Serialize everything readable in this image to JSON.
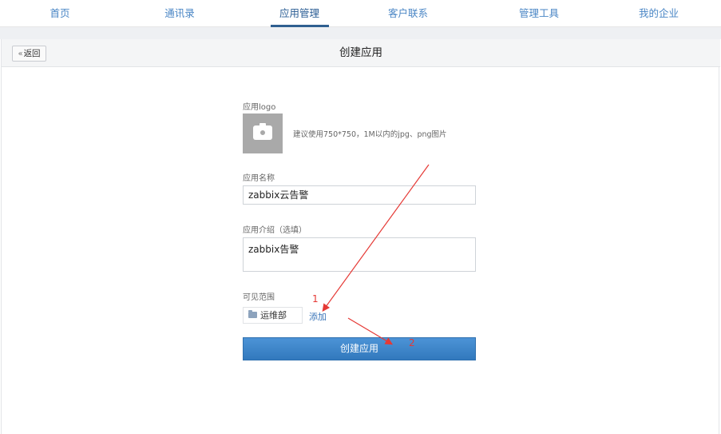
{
  "nav": {
    "items": [
      {
        "label": "首页"
      },
      {
        "label": "通讯录"
      },
      {
        "label": "应用管理"
      },
      {
        "label": "客户联系"
      },
      {
        "label": "管理工具"
      },
      {
        "label": "我的企业"
      }
    ],
    "active_index": 2,
    "accent_color": "#2f5f90"
  },
  "header": {
    "back_label": "返回",
    "back_icon": "double-chevron-left-icon",
    "title": "创建应用"
  },
  "form": {
    "logo_label": "应用logo",
    "logo_icon": "camera-icon",
    "logo_hint": "建议使用750*750，1M以内的jpg、png图片",
    "name_label": "应用名称",
    "name_value": "zabbix云告警",
    "desc_label": "应用介绍（选填）",
    "desc_value": "zabbix告警",
    "scope_label": "可见范围",
    "scope_dept": "运维部",
    "scope_icon": "folder-icon",
    "add_label": "添加",
    "submit_label": "创建应用",
    "submit_color": "#3e86cb"
  },
  "annotations": {
    "marker_1": "1",
    "marker_2": "2",
    "arrow_color": "#e53935"
  }
}
